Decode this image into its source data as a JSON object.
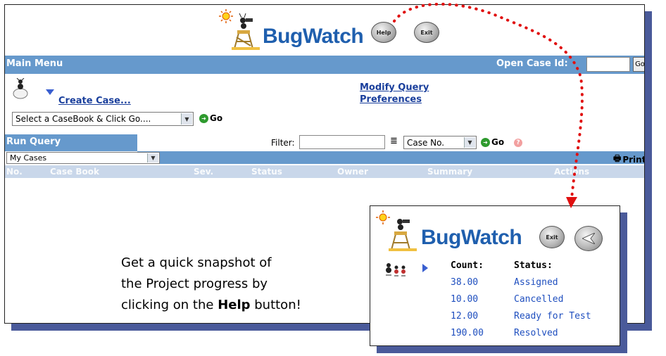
{
  "main": {
    "logo_text": "BugWatch",
    "help_button": "Help",
    "exit_button": "Exit",
    "menu_bar": {
      "title": "Main Menu",
      "open_case_label": "Open Case Id:",
      "open_case_value": "",
      "go_label": "Go"
    },
    "create_case_link": "Create Case...",
    "casebook_select": "Select a CaseBook & Click Go....",
    "go_label": "Go",
    "links": [
      "Modify Query",
      "Preferences"
    ],
    "query_bar": {
      "title": "Run Query",
      "filter_label": "Filter:",
      "filter_value": "",
      "sort_select": "Case No.",
      "go_label": "Go"
    },
    "cases_select": "My Cases",
    "print_label": "Print",
    "columns": [
      "No.",
      "Case Book",
      "Sev.",
      "Status",
      "Owner",
      "Summary",
      "Actions"
    ]
  },
  "caption": {
    "line1": "Get a quick snapshot of",
    "line2": "the Project progress by",
    "line3_prefix": "clicking on the ",
    "line3_bold": "Help",
    "line3_suffix": " button!"
  },
  "popup": {
    "logo_text": "BugWatch",
    "exit_button": "Exit",
    "headers": {
      "count": "Count:",
      "status": "Status:"
    },
    "rows": [
      {
        "count": "38.00",
        "status": "Assigned"
      },
      {
        "count": "10.00",
        "status": "Cancelled"
      },
      {
        "count": "12.00",
        "status": "Ready for Test"
      },
      {
        "count": "190.00",
        "status": "Resolved"
      }
    ]
  },
  "colors": {
    "header_bar": "#6699cc",
    "link_blue": "#1a3f9c",
    "annotation_red": "#e01010",
    "shadow": "#4a5a9a"
  }
}
